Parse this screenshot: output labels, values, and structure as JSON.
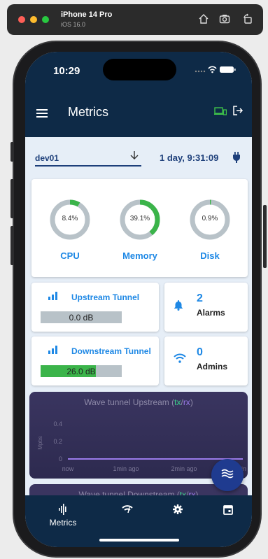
{
  "simulator": {
    "device": "iPhone 14 Pro",
    "os": "iOS 16.0",
    "icons": [
      "home-icon",
      "screenshot-icon",
      "rotate-icon"
    ]
  },
  "status_bar": {
    "time": "10:29"
  },
  "app_bar": {
    "title": "Metrics"
  },
  "device": {
    "name": "dev01",
    "uptime": "1 day, 9:31:09"
  },
  "usage": [
    {
      "label": "CPU",
      "value": "8.4%",
      "percent": 8.4
    },
    {
      "label": "Memory",
      "value": "39.1%",
      "percent": 39.1
    },
    {
      "label": "Disk",
      "value": "0.9%",
      "percent": 0.9
    }
  ],
  "tunnels": {
    "upstream": {
      "title": "Upstream Tunnel",
      "value": "0.0 dB",
      "fill": 0
    },
    "downstream": {
      "title": "Downstream Tunnel",
      "value": "26.0 dB",
      "fill": 0.68
    }
  },
  "stats": {
    "alarms": {
      "count": "2",
      "label": "Alarms"
    },
    "admins": {
      "count": "0",
      "label": "Admins"
    }
  },
  "chart_up": {
    "title_prefix": "Wave tunnel Upstream (",
    "tx": "tx",
    "sep": "/",
    "rx": "rx",
    "title_suffix": ")"
  },
  "chart_down": {
    "title_prefix": "Wave tunnel Downstream (",
    "tx": "tx",
    "sep": "/",
    "rx": "rx",
    "title_suffix": ")"
  },
  "chart_data": {
    "type": "line",
    "title": "Wave tunnel Upstream (tx/rx)",
    "ylabel": "Mpbs",
    "xlabel": "",
    "x_ticks": [
      "now",
      "1min ago",
      "2min ago",
      "3min a"
    ],
    "y_ticks": [
      "0",
      "0.2",
      "0.4"
    ],
    "ylim": [
      0,
      0.4
    ],
    "series": [
      {
        "name": "tx",
        "values": [
          0,
          0,
          0,
          0
        ]
      },
      {
        "name": "rx",
        "values": [
          0,
          0,
          0,
          0
        ]
      }
    ]
  },
  "nav": {
    "items": [
      {
        "label": "Metrics",
        "icon": "waveform-icon"
      },
      {
        "label": "",
        "icon": "wifi-icon"
      },
      {
        "label": "",
        "icon": "gear-icon"
      },
      {
        "label": "",
        "icon": "calendar-icon"
      }
    ]
  },
  "colors": {
    "app_bar": "#0e2a47",
    "accent": "#1e88e5",
    "gauge_fill": "#3bb44a",
    "gauge_track": "#b8c2c8",
    "chart_bg": "#3a3560",
    "chart_line": "#9a7bea",
    "fab": "#1f3b8f"
  }
}
